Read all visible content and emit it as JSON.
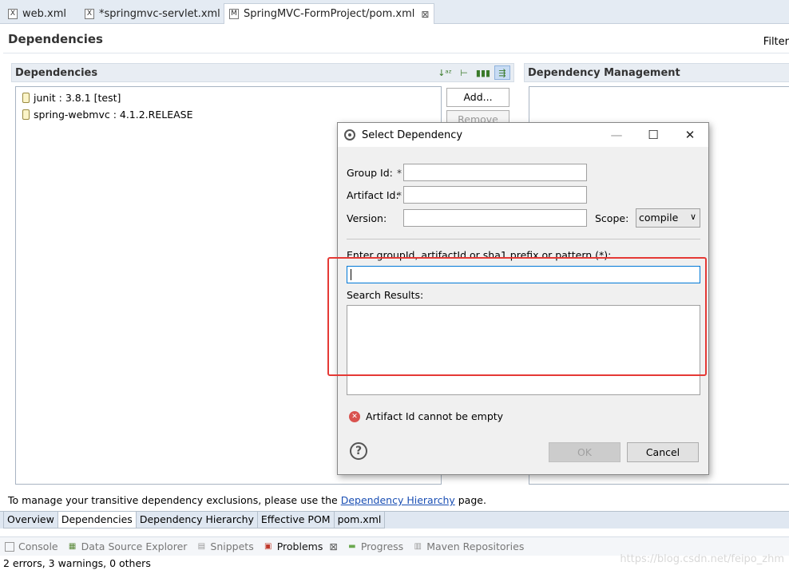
{
  "editor_tabs": [
    {
      "label": "web.xml",
      "icon": "X"
    },
    {
      "label": "*springmvc-servlet.xml",
      "icon": "X"
    },
    {
      "label": "SpringMVC-FormProject/pom.xml",
      "icon": "M",
      "close": "⊠"
    }
  ],
  "page": {
    "title": "Dependencies",
    "filter_label": "Filter"
  },
  "dependencies_section": {
    "title": "Dependencies",
    "items": [
      {
        "label": "junit : 3.8.1 [test]"
      },
      {
        "label": "spring-webmvc : 4.1.2.RELEASE"
      }
    ],
    "add_button": "Add...",
    "remove_button": "Remove"
  },
  "management_section": {
    "title": "Dependency Management"
  },
  "bottom_note": {
    "prefix": "To manage your transitive dependency exclusions, please use the ",
    "link": "Dependency Hierarchy",
    "suffix": " page."
  },
  "page_tabs": [
    "Overview",
    "Dependencies",
    "Dependency Hierarchy",
    "Effective POM",
    "pom.xml"
  ],
  "views": [
    {
      "label": "Console"
    },
    {
      "label": "Data Source Explorer"
    },
    {
      "label": "Snippets"
    },
    {
      "label": "Problems",
      "close": "⊠"
    },
    {
      "label": "Progress"
    },
    {
      "label": "Maven Repositories"
    }
  ],
  "status_line": "2 errors, 3 warnings, 0 others",
  "watermark": "https://blog.csdn.net/feipo_zhm",
  "dialog": {
    "title": "Select Dependency",
    "group_id_label": "Group Id:",
    "artifact_id_label": "Artifact Id:",
    "version_label": "Version:",
    "required_mark": "*",
    "scope_label": "Scope:",
    "scope_value": "compile",
    "search_prompt": "Enter groupId, artifactId or sha1 prefix or pattern (*):",
    "results_label": "Search Results:",
    "error_message": "Artifact Id cannot be empty",
    "ok_button": "OK",
    "cancel_button": "Cancel"
  },
  "colors": {
    "highlight": "#e53935",
    "link": "#1a4fb4",
    "error": "#d9534f",
    "focus": "#0078d7"
  }
}
